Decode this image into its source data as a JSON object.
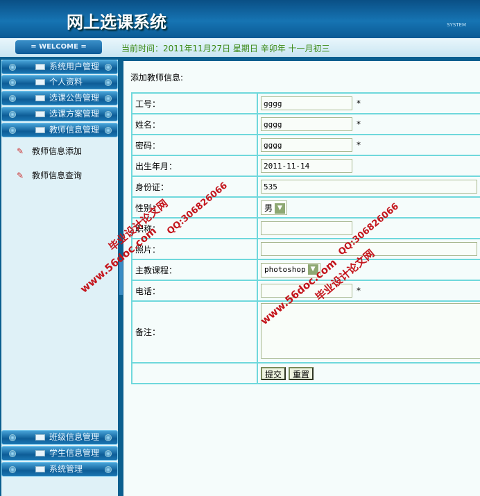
{
  "header": {
    "title": "网上选课系统",
    "system_label": "SYSTEM"
  },
  "bar": {
    "welcome": "= WELCOME =",
    "time": "当前时间：2011年11月27日 星期日 辛卯年 十一月初三"
  },
  "sidebar": {
    "items": [
      {
        "label": "系统用户管理"
      },
      {
        "label": "个人资料"
      },
      {
        "label": "选课公告管理"
      },
      {
        "label": "选课方案管理"
      },
      {
        "label": "教师信息管理"
      }
    ],
    "sub_items": [
      {
        "label": "教师信息添加"
      },
      {
        "label": "教师信息查询"
      }
    ],
    "bottom_items": [
      {
        "label": "班级信息管理"
      },
      {
        "label": "学生信息管理"
      },
      {
        "label": "系统管理"
      }
    ]
  },
  "form": {
    "heading": "添加教师信息:",
    "fields": {
      "id": {
        "label": "工号：",
        "value": "gggg"
      },
      "name": {
        "label": "姓名：",
        "value": "gggg"
      },
      "password": {
        "label": "密码：",
        "value": "gggg"
      },
      "birth": {
        "label": "出生年月：",
        "value": "2011-11-14"
      },
      "idcard": {
        "label": "身份证：",
        "value": "535"
      },
      "gender": {
        "label": "性别：",
        "value": "男"
      },
      "title": {
        "label": "职称：",
        "value": ""
      },
      "photo": {
        "label": "照片：",
        "value": ""
      },
      "course": {
        "label": "主教课程：",
        "value": "photoshop"
      },
      "phone": {
        "label": "电话：",
        "value": ""
      },
      "remark": {
        "label": "备注：",
        "value": ""
      }
    },
    "required_mark": "*",
    "submit": "提交",
    "reset": "重置"
  },
  "watermark": {
    "site": "毕业设计论文网",
    "url": "www.56doc.com",
    "qq": "QQ:306826066"
  }
}
